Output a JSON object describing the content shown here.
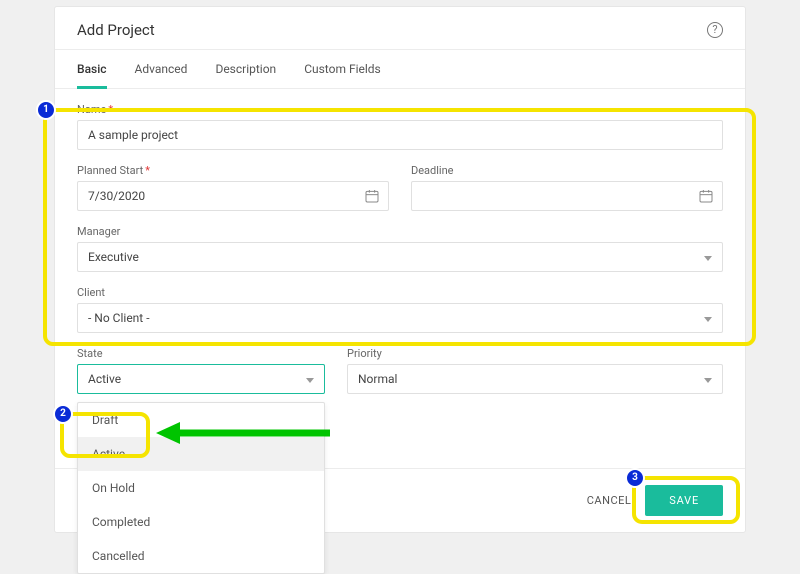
{
  "dialog": {
    "title": "Add Project"
  },
  "tabs": {
    "items": [
      "Basic",
      "Advanced",
      "Description",
      "Custom Fields"
    ],
    "active": "Basic"
  },
  "fields": {
    "name_label": "Name",
    "name_value": "A sample project",
    "planned_start_label": "Planned Start",
    "planned_start_value": "7/30/2020",
    "deadline_label": "Deadline",
    "deadline_value": "",
    "manager_label": "Manager",
    "manager_value": "Executive",
    "client_label": "Client",
    "client_value": "- No Client -",
    "state_label": "State",
    "state_value": "Active",
    "priority_label": "Priority",
    "priority_value": "Normal"
  },
  "state_options": [
    "Draft",
    "Active",
    "On Hold",
    "Completed",
    "Cancelled"
  ],
  "footer": {
    "cancel_label": "CANCEL",
    "save_label": "SAVE"
  },
  "callouts": {
    "c1": "1",
    "c2": "2",
    "c3": "3"
  },
  "icons": {
    "calendar": "calendar-icon",
    "help": "help-icon"
  }
}
